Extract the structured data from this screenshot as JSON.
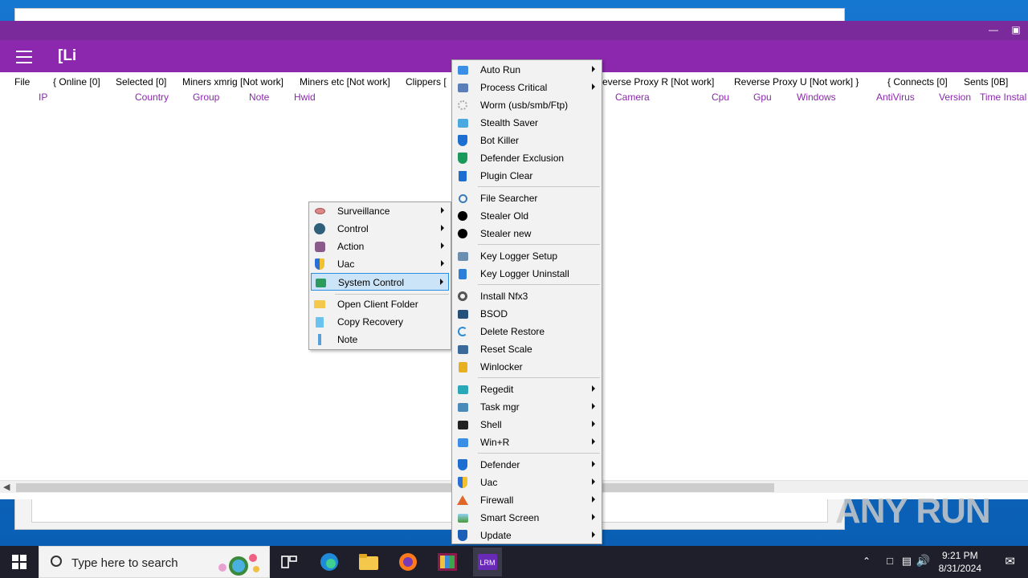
{
  "app": {
    "title": "[Li",
    "titlebar_color": "#7b2a9b",
    "header_color": "#8b28ad",
    "accent_color": "#8b28ad"
  },
  "stats": {
    "file": "File",
    "online": "{ Online [0]",
    "selected": "Selected [0]",
    "miners_xmrig": "Miners xmrig [Not work]",
    "miners_etc": "Miners etc [Not work]",
    "clippers": "Clippers [",
    "reverse_proxy_r": "everse Proxy R [Not work]",
    "reverse_proxy_u": "Reverse Proxy U [Not work] }",
    "connects": "{ Connects [0]",
    "sents": "Sents [0B]"
  },
  "columns": [
    "IP",
    "Country",
    "Group",
    "Note",
    "Hwid",
    "Camera",
    "Cpu",
    "Gpu",
    "Windows",
    "AntiVirus",
    "Version",
    "Time Instal"
  ],
  "context_menu": {
    "items": [
      {
        "label": "Surveillance",
        "icon": "eye-icon",
        "submenu": true
      },
      {
        "label": "Control",
        "icon": "control-icon",
        "submenu": true
      },
      {
        "label": "Action",
        "icon": "action-icon",
        "submenu": true
      },
      {
        "label": "Uac",
        "icon": "uac-shield-icon",
        "submenu": true
      },
      {
        "label": "System Control",
        "icon": "system-control-icon",
        "submenu": true,
        "selected": true
      },
      {
        "label": "Open Client Folder",
        "icon": "folder-icon",
        "submenu": false
      },
      {
        "label": "Copy Recovery",
        "icon": "copy-icon",
        "submenu": false
      },
      {
        "label": "Note",
        "icon": "note-icon",
        "submenu": false
      }
    ]
  },
  "submenu": {
    "items": [
      {
        "label": "Auto Run",
        "icon": "autorun-icon",
        "submenu": true
      },
      {
        "label": "Process Critical",
        "icon": "process-icon",
        "submenu": true
      },
      {
        "label": "Worm (usb/smb/Ftp)",
        "icon": "worm-icon",
        "submenu": false
      },
      {
        "label": "Stealth Saver",
        "icon": "stealth-icon",
        "submenu": false
      },
      {
        "label": "Bot Killer",
        "icon": "bot-killer-shield-icon",
        "submenu": false
      },
      {
        "label": "Defender Exclusion",
        "icon": "defender-exclusion-shield-icon",
        "submenu": false
      },
      {
        "label": "Plugin Clear",
        "icon": "trash-icon",
        "submenu": false
      },
      {
        "label": "File Searcher",
        "icon": "search-icon",
        "submenu": false
      },
      {
        "label": "Stealer Old",
        "icon": "skull-icon",
        "submenu": false
      },
      {
        "label": "Stealer new",
        "icon": "skull-icon",
        "submenu": false
      },
      {
        "label": "Key Logger Setup",
        "icon": "keylogger-icon",
        "submenu": false
      },
      {
        "label": "Key Logger Uninstall",
        "icon": "uninstall-icon",
        "submenu": false
      },
      {
        "label": "Install Nfx3",
        "icon": "gear-icon",
        "submenu": false
      },
      {
        "label": "BSOD",
        "icon": "monitor-icon",
        "submenu": false
      },
      {
        "label": "Delete Restore",
        "icon": "restore-icon",
        "submenu": false
      },
      {
        "label": "Reset Scale",
        "icon": "scale-icon",
        "submenu": false
      },
      {
        "label": "Winlocker",
        "icon": "lock-icon",
        "submenu": false
      },
      {
        "label": "Regedit",
        "icon": "regedit-icon",
        "submenu": true
      },
      {
        "label": "Task mgr",
        "icon": "task-manager-icon",
        "submenu": true
      },
      {
        "label": "Shell",
        "icon": "terminal-icon",
        "submenu": true
      },
      {
        "label": "Win+R",
        "icon": "run-icon",
        "submenu": true
      },
      {
        "label": "Defender",
        "icon": "defender-shield-icon",
        "submenu": true
      },
      {
        "label": "Uac",
        "icon": "uac-shield-icon",
        "submenu": true
      },
      {
        "label": "Firewall",
        "icon": "firewall-icon",
        "submenu": true
      },
      {
        "label": "Smart Screen",
        "icon": "smart-screen-icon",
        "submenu": true
      },
      {
        "label": "Update",
        "icon": "update-shield-icon",
        "submenu": true
      }
    ]
  },
  "taskbar": {
    "search_placeholder": "Type here to search",
    "time": "9:21 PM",
    "date": "8/31/2024",
    "apps": [
      "task-view-icon",
      "edge-icon",
      "file-explorer-icon",
      "firefox-icon",
      "winrar-icon",
      "lrm-icon"
    ]
  },
  "watermark": "ANY RUN"
}
